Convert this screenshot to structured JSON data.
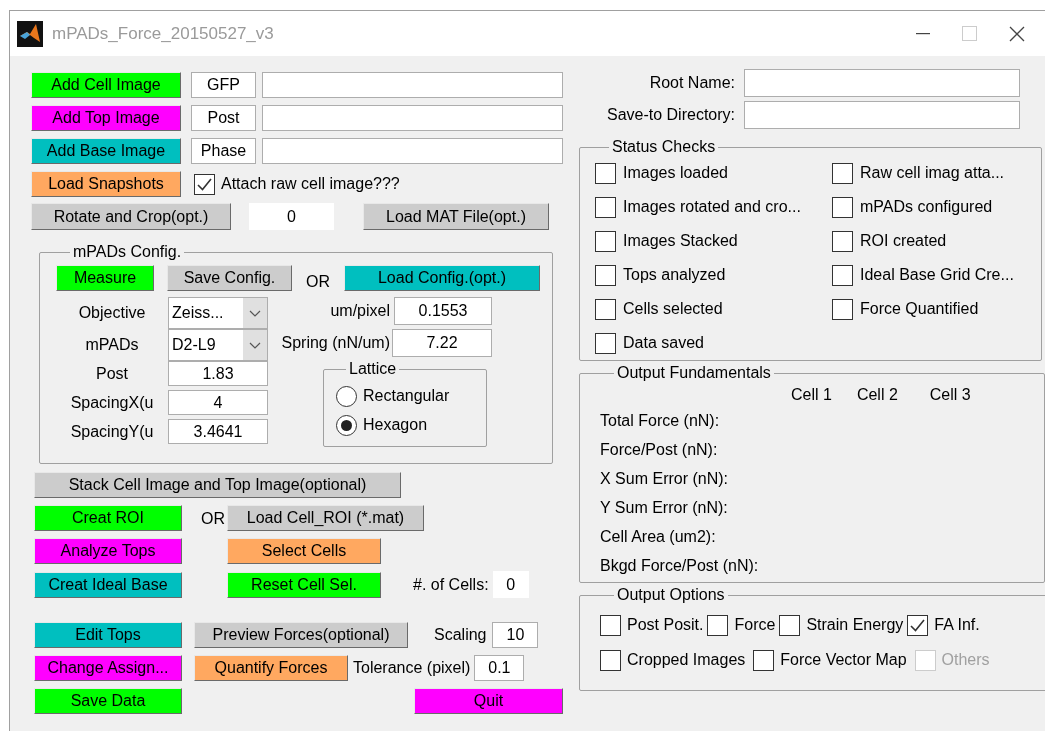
{
  "window": {
    "title": "mPADs_Force_20150527_v3"
  },
  "image_inputs": [
    {
      "button": {
        "label": "Add Cell Image",
        "color": "#00ff00"
      },
      "channel": "GFP"
    },
    {
      "button": {
        "label": "Add Top Image",
        "color": "#ff00ff"
      },
      "channel": "Post"
    },
    {
      "button": {
        "label": "Add Base Image",
        "color": "#00bfbf"
      },
      "channel": "Phase"
    }
  ],
  "load_snapshots": {
    "label": "Load Snapshots",
    "color": "#ffa860"
  },
  "attach_raw": {
    "label": "Attach raw cell image???",
    "checked": true
  },
  "rotate_crop": {
    "label": "Rotate and Crop(opt.)",
    "color": "#cccccc"
  },
  "rotation_value": "0",
  "load_mat": {
    "label": "Load MAT File(opt.)",
    "color": "#cccccc"
  },
  "config": {
    "title": "mPADs Config.",
    "measure": {
      "label": "Measure",
      "color": "#00ff00"
    },
    "save": {
      "label": "Save Config.",
      "color": "#cccccc"
    },
    "or_label": "OR",
    "load": {
      "label": "Load Config.(opt.)",
      "color": "#00bfbf"
    },
    "fields": [
      {
        "label": "Objective",
        "value": "Zeiss...",
        "kind": "dropdown"
      },
      {
        "label": "mPADs",
        "value": "D2-L9",
        "kind": "dropdown"
      },
      {
        "label": "Post",
        "value": "1.83",
        "kind": "text"
      },
      {
        "label": "SpacingX(u",
        "value": "4",
        "kind": "text"
      },
      {
        "label": "SpacingY(u",
        "value": "3.4641",
        "kind": "text"
      }
    ],
    "um_per_pixel": {
      "label": "um/pixel",
      "value": "0.1553"
    },
    "spring": {
      "label": "Spring (nN/um)",
      "value": "7.22"
    },
    "lattice": {
      "title": "Lattice",
      "options": [
        {
          "label": "Rectangular",
          "selected": false
        },
        {
          "label": "Hexagon",
          "selected": true
        }
      ]
    }
  },
  "stack": {
    "label": "Stack Cell Image and Top Image(optional)",
    "color": "#cccccc"
  },
  "creat_roi": {
    "label": "Creat ROI",
    "color": "#00ff00"
  },
  "or_label": "OR",
  "load_roi": {
    "label": "Load Cell_ROI (*.mat)",
    "color": "#cccccc"
  },
  "analyze_tops": {
    "label": "Analyze Tops",
    "color": "#ff00ff"
  },
  "select_cells": {
    "label": "Select Cells",
    "color": "#ffa860"
  },
  "creat_ideal_base": {
    "label": "Creat Ideal Base",
    "color": "#00bfbf"
  },
  "reset_cell_sel": {
    "label": "Reset Cell Sel.",
    "color": "#00ff00"
  },
  "cell_count": {
    "label": "#. of Cells:",
    "value": "0"
  },
  "edit_tops": {
    "label": "Edit Tops",
    "color": "#00bfbf"
  },
  "preview_forces": {
    "label": "Preview Forces(optional)",
    "color": "#cccccc"
  },
  "scaling": {
    "label": "Scaling",
    "value": "10"
  },
  "change_assign": {
    "label": "Change Assign...",
    "color": "#ff00ff"
  },
  "quantify_forces": {
    "label": "Quantify Forces",
    "color": "#ffa860"
  },
  "tolerance": {
    "label": "Tolerance (pixel)",
    "value": "0.1"
  },
  "save_data": {
    "label": "Save Data",
    "color": "#00ff00"
  },
  "quit": {
    "label": "Quit",
    "color": "#ff00ff"
  },
  "root_name": {
    "label": "Root Name:"
  },
  "save_dir": {
    "label": "Save-to Directory:"
  },
  "status_checks": {
    "title": "Status Checks",
    "columns": [
      {
        "items": [
          {
            "label": "Images loaded",
            "checked": false
          },
          {
            "label": "Images rotated and cro...",
            "checked": false
          },
          {
            "label": "Images Stacked",
            "checked": false
          },
          {
            "label": "Tops analyzed",
            "checked": false
          },
          {
            "label": "Cells selected",
            "checked": false
          },
          {
            "label": "Data saved",
            "checked": false
          }
        ]
      },
      {
        "items": [
          {
            "label": "Raw cell imag atta...",
            "checked": false
          },
          {
            "label": "mPADs configured",
            "checked": false
          },
          {
            "label": "ROI created",
            "checked": false
          },
          {
            "label": "Ideal Base Grid Cre...",
            "checked": false
          },
          {
            "label": "Force Quantified",
            "checked": false
          }
        ]
      }
    ]
  },
  "output_fundamentals": {
    "title": "Output Fundamentals",
    "columns": [
      "Cell 1",
      "Cell 2",
      "Cell 3"
    ],
    "rows": [
      "Total Force (nN):",
      "Force/Post (nN):",
      "X Sum Error (nN):",
      "Y Sum Error (nN):",
      "Cell Area (um2):",
      "Bkgd Force/Post (nN):"
    ]
  },
  "output_options": {
    "title": "Output Options",
    "rows": [
      {
        "items": [
          {
            "label": "Post Posit.",
            "checked": false,
            "disabled": false
          },
          {
            "label": "Force",
            "checked": false,
            "disabled": false
          },
          {
            "label": "Strain Energy",
            "checked": false,
            "disabled": false
          },
          {
            "label": "FA Inf.",
            "checked": true,
            "disabled": false
          }
        ]
      },
      {
        "items": [
          {
            "label": "Cropped Images",
            "checked": false,
            "disabled": false
          },
          {
            "label": "Force Vector Map",
            "checked": false,
            "disabled": false
          },
          {
            "label": "Others",
            "checked": false,
            "disabled": true
          }
        ]
      }
    ]
  }
}
